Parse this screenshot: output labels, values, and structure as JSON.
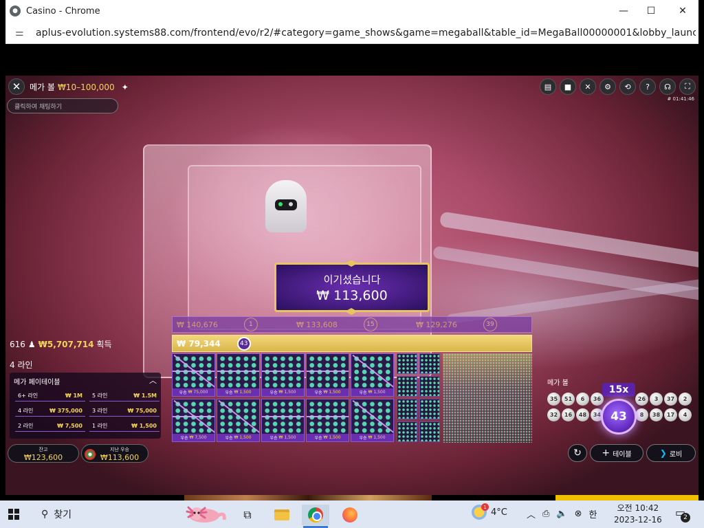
{
  "browser": {
    "tab_title": "Casino - Chrome",
    "url": "aplus-evolution.systems88.com/frontend/evo/r2/#category=game_shows&game=megaball&table_id=MegaBall00000001&lobby_launch_id=dc0883...",
    "minimize_glyph": "—",
    "maximize_glyph": "☐",
    "close_glyph": "✕"
  },
  "game": {
    "title": "메가 볼",
    "limits": "₩10–100,000",
    "chat_placeholder": "클릭하여 채팅하기",
    "round_id": "# 01:41:46",
    "close_glyph": "✕",
    "star_glyph": "✦",
    "top_icons": [
      {
        "name": "chat-icon",
        "glyph": "▤"
      },
      {
        "name": "video-icon",
        "glyph": "■"
      },
      {
        "name": "mute-icon",
        "glyph": "✕"
      },
      {
        "name": "settings-icon",
        "glyph": "⚙"
      },
      {
        "name": "history-icon",
        "glyph": "⟲"
      },
      {
        "name": "help-icon",
        "glyph": "?"
      },
      {
        "name": "support-icon",
        "glyph": "☊"
      },
      {
        "name": "fullscreen-icon",
        "glyph": "⛶"
      }
    ]
  },
  "win_banner": {
    "label": "이기셨습니다",
    "amount": "₩ 113,600"
  },
  "win_rows": [
    {
      "amount": "₩ 140,676",
      "ball": "1"
    },
    {
      "amount": "₩ 133,608",
      "ball": "15"
    },
    {
      "amount": "₩ 129,276",
      "ball": "39"
    }
  ],
  "gold_row": {
    "amount": "₩ 79,344",
    "ball": "43"
  },
  "cards": [
    {
      "prize_label": "우승",
      "prize": "₩ 75,000"
    },
    {
      "prize_label": "우승",
      "prize": "₩ 1,500"
    },
    {
      "prize_label": "우승",
      "prize": "₩ 1,500"
    },
    {
      "prize_label": "우승",
      "prize": "₩ 1,500"
    },
    {
      "prize_label": "우승",
      "prize": "₩ 1,500"
    },
    {
      "prize_label": "우승",
      "prize": "₩ 7,500"
    },
    {
      "prize_label": "우승",
      "prize": "₩ 1,500"
    },
    {
      "prize_label": "우승",
      "prize": "₩ 1,500"
    },
    {
      "prize_label": "우승",
      "prize": "₩ 1,500"
    },
    {
      "prize_label": "우승",
      "prize": "₩ 1,500"
    }
  ],
  "stats": {
    "count": "616",
    "person_glyph": "♟",
    "total": "₩5,707,714",
    "suffix": "획득",
    "lines": "4 라인"
  },
  "paytable": {
    "title": "메가 페이테이블",
    "chevron": "︿",
    "rows": [
      {
        "label": "6+ 라인",
        "value": "₩ 1M"
      },
      {
        "label": "5 라인",
        "value": "₩ 1.5M"
      },
      {
        "label": "4 라인",
        "value": "₩ 375,000"
      },
      {
        "label": "3 라인",
        "value": "₩ 75,000"
      },
      {
        "label": "2 라인",
        "value": "₩ 7,500"
      },
      {
        "label": "1 라인",
        "value": "₩ 1,500"
      }
    ]
  },
  "balance": {
    "label": "잔고",
    "value": "₩123,600"
  },
  "last_win": {
    "label": "지난 우승",
    "value": "₩113,600"
  },
  "megaball": {
    "label": "메가 볼",
    "multiplier": "15x",
    "number": "43",
    "balls_row1": [
      "35",
      "51",
      "6",
      "36",
      "26",
      "3",
      "37",
      "2"
    ],
    "balls_row2": [
      "32",
      "16",
      "48",
      "34",
      "8",
      "38",
      "17",
      "4"
    ]
  },
  "controls": {
    "replay_glyph": "↻",
    "table_glyph": "+",
    "table_label": "테이블",
    "lobby_glyph": "❯",
    "lobby_label": "로비"
  },
  "taskbar": {
    "search_glyph": "⚲",
    "search_label": "찾기",
    "taskview_glyph": "⧉",
    "weather_badge": "1",
    "temperature": "4°C",
    "tray_up": "︿",
    "tray_network": "⎙",
    "tray_volume": "🔈",
    "tray_x": "⊗",
    "ime": "한",
    "time": "오전 10:42",
    "date": "2023-12-16",
    "notif_glyph": "▭",
    "notif_count": "2"
  }
}
